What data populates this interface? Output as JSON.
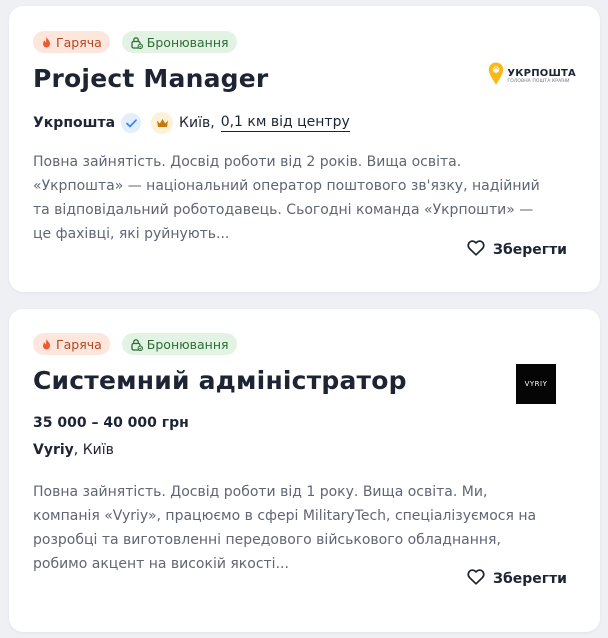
{
  "vacancies": [
    {
      "tags": {
        "hot": "Гаряча",
        "booking": "Бронювання"
      },
      "title": "Project Manager",
      "company": "Укрпошта",
      "city": "Київ,",
      "distance": "0,1 км від центру",
      "logo": {
        "name": "УКРПОШТА",
        "subtitle": "ГОЛОВНА ПОШТА КРАЇНИ",
        "color": "#f9b917"
      },
      "description": "Повна зайнятість. Досвід роботи від 2 років. Вища освіта. «Укрпошта» — національний оператор поштового зв'язку, надійний та відповідальний роботодавець. Сьогодні команда «Укрпошти» — це фахівці, які руйнують...",
      "save_label": "Зберегти"
    },
    {
      "tags": {
        "hot": "Гаряча",
        "booking": "Бронювання"
      },
      "title": "Системний адміністратор",
      "salary": "35 000 – 40 000 грн",
      "company": "Vyriy",
      "city": ", Київ",
      "logo": {
        "name": "VYRIY"
      },
      "description": "Повна зайнятість. Досвід роботи від 1 року. Вища освіта. Ми, компанія «Vyriy», працюємо в сфері MilitaryTech, спеціалізуємося на розробці та виготовленні передового військового обладнання, робимо акцент на високій якості...",
      "save_label": "Зберегти"
    }
  ],
  "colors": {
    "background": "#eef0f4",
    "hot_tag_bg": "#fde6dc",
    "booking_tag_bg": "#e2f3e4",
    "verified": "#3b82f6",
    "crown": "#c8790b"
  },
  "icons": [
    "flame-icon",
    "lock-icon",
    "verified-check-icon",
    "crown-icon",
    "heart-outline-icon"
  ]
}
